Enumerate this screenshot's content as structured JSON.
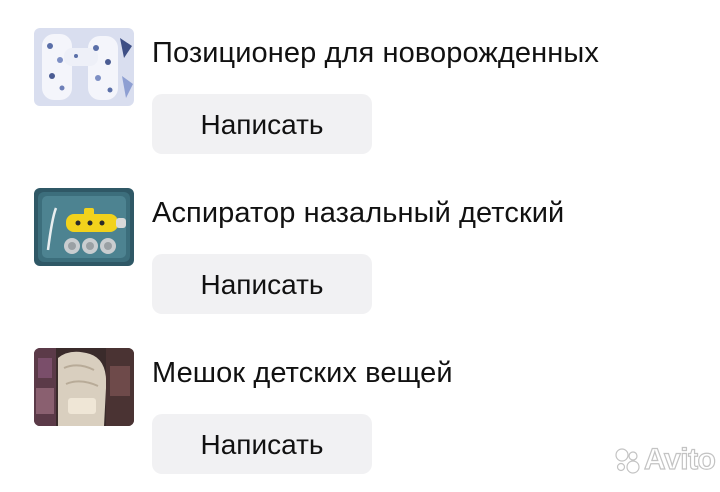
{
  "listings": [
    {
      "title": "Позиционер для новорожденных",
      "button_label": "Написать",
      "thumbnail_icon": "positioner-photo"
    },
    {
      "title": "Аспиратор назальный детский",
      "button_label": "Написать",
      "thumbnail_icon": "aspirator-photo"
    },
    {
      "title": "Мешок детских вещей",
      "button_label": "Написать",
      "thumbnail_icon": "clothes-bag-photo"
    }
  ],
  "watermark": {
    "brand": "Avito"
  },
  "colors": {
    "button_bg": "#f1f1f3",
    "text": "#111111"
  }
}
